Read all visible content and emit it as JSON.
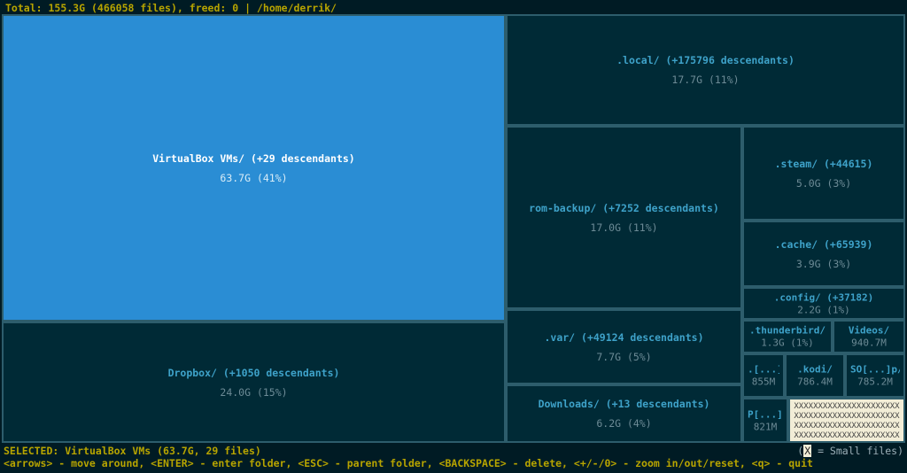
{
  "header": {
    "total_label": "Total:",
    "total_size": "155.3G",
    "file_count": "(466058 files)",
    "freed_label": "freed:",
    "freed_value": "0",
    "path": "/home/derrik/"
  },
  "blocks": {
    "virtualbox": {
      "title": "VirtualBox VMs/ (+29 descendants)",
      "size": "63.7G (41%)"
    },
    "dropbox": {
      "title": "Dropbox/ (+1050 descendants)",
      "size": "24.0G (15%)"
    },
    "local": {
      "title": ".local/ (+175796 descendants)",
      "size": "17.7G (11%)"
    },
    "rombackup": {
      "title": "rom-backup/ (+7252 descendants)",
      "size": "17.0G (11%)"
    },
    "var": {
      "title": ".var/ (+49124 descendants)",
      "size": "7.7G (5%)"
    },
    "downloads": {
      "title": "Downloads/ (+13 descendants)",
      "size": "6.2G (4%)"
    },
    "steam": {
      "title": ".steam/ (+44615)",
      "size": "5.0G (3%)"
    },
    "cache": {
      "title": ".cache/ (+65939)",
      "size": "3.9G (3%)"
    },
    "config": {
      "title": ".config/ (+37182)",
      "size": "2.2G (1%)"
    },
    "thunderbird": {
      "title": ".thunderbird/",
      "size": "1.3G (1%)"
    },
    "videos": {
      "title": "Videos/",
      "size": "940.7M"
    },
    "dot1": {
      "title": ".[...]/",
      "size": "855M"
    },
    "kodi": {
      "title": ".kodi/",
      "size": "786.4M"
    },
    "so": {
      "title": "SO[...]p/",
      "size": "785.2M"
    },
    "p": {
      "title": "P[...]/",
      "size": "821M"
    },
    "smallfiles": "XXXXXXXXXXXXXXXXXXXXXXXXXXXXXXXXXXXXXXXXXXXXXXXXXXXXXXXXXXXXXXXXXXXXXXXXXXXXXXXXXXXXXXXXXXXXXXXXXXXXXXXXXXXX"
  },
  "footer": {
    "selected_label": "SELECTED:",
    "selected_value": "VirtualBox VMs (63.7G, 29 files)",
    "help": "<arrows> - move around, <ENTER> - enter folder, <ESC> - parent folder, <BACKSPACE> - delete, <+/-/0> - zoom in/out/reset, <q> - quit",
    "legend": "= Small files)",
    "legend_box": "X"
  }
}
